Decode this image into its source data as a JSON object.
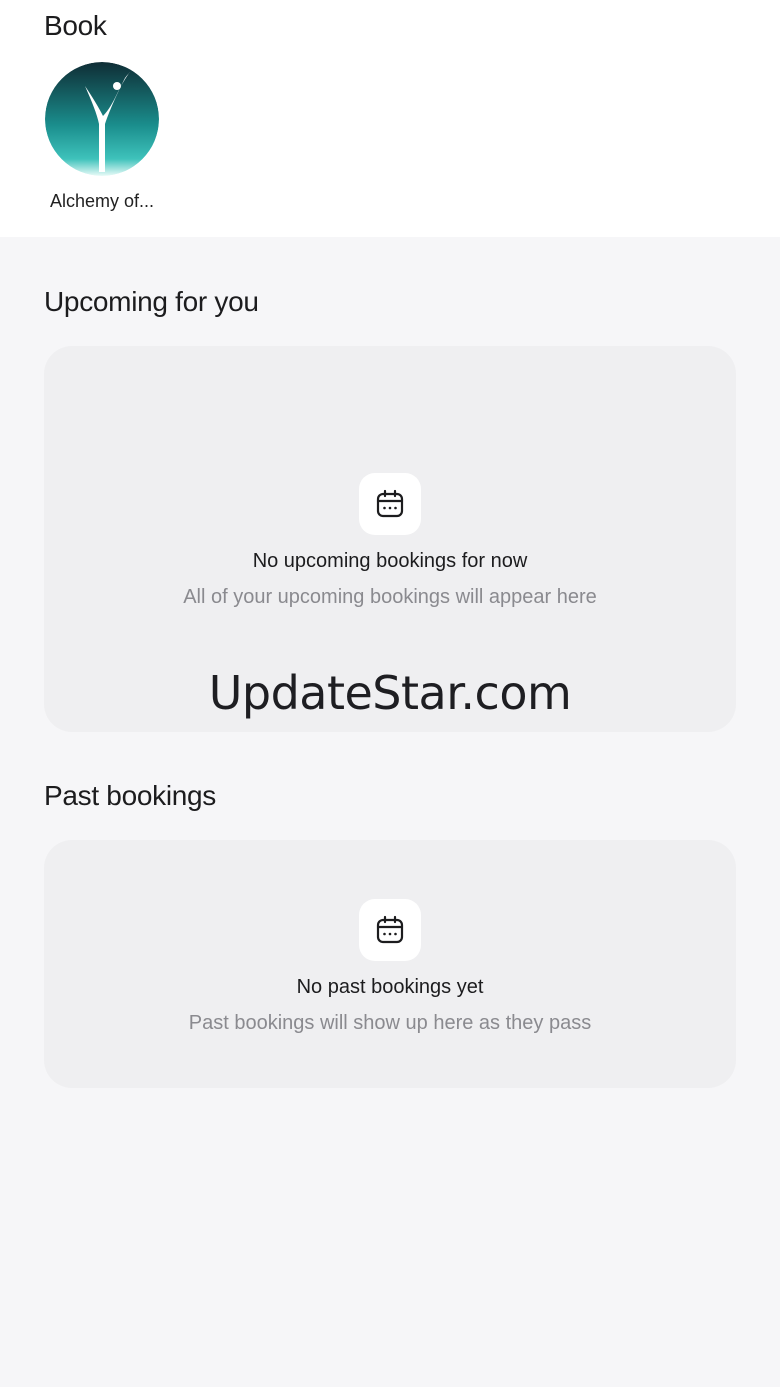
{
  "header": {
    "title": "Book"
  },
  "studios": [
    {
      "name": "Alchemy of...",
      "icon": "dancer-logo-icon"
    }
  ],
  "upcoming": {
    "section_title": "Upcoming for you",
    "empty_title": "No upcoming bookings for now",
    "empty_subtitle": "All of your upcoming bookings will appear here",
    "icon": "calendar-icon"
  },
  "past": {
    "section_title": "Past bookings",
    "empty_title": "No past bookings yet",
    "empty_subtitle": "Past bookings will show up here as they pass",
    "icon": "calendar-icon"
  },
  "watermark": "UpdateStar.com",
  "colors": {
    "page_background": "#f6f6f8",
    "card_background": "#efeff1",
    "logo_teal": "#1fa6a0",
    "logo_dark": "#0f2d35"
  }
}
